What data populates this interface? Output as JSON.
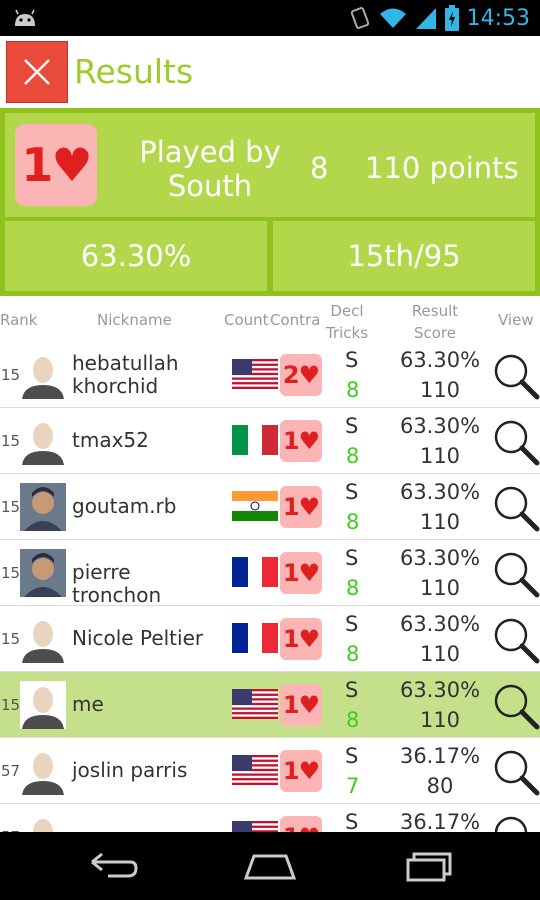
{
  "status_bar": {
    "time": "14:53",
    "icons": [
      "android-icon",
      "vibrate-icon",
      "wifi-icon",
      "signal-icon",
      "battery-icon"
    ]
  },
  "header": {
    "title": "Results",
    "close_icon": "close-icon"
  },
  "summary": {
    "contract": "1♥",
    "played_by": "Played by South",
    "tricks": "8",
    "points": "110 points",
    "percentage": "63.30%",
    "ranking": "15th/95"
  },
  "columns": {
    "rank": "Rank",
    "nickname": "Nickname",
    "country": "Country",
    "contract": "Contract",
    "decl": "Decl",
    "tricks": "Tricks",
    "result": "Result",
    "score": "Score",
    "view": "View"
  },
  "rows": [
    {
      "rank": "15",
      "nickname": "hebatullah khorchid",
      "avatar": "default",
      "country": "us",
      "contract": "2♥",
      "declarer": "S",
      "tricks": "8",
      "percent": "63.30%",
      "score": "110",
      "highlight": false
    },
    {
      "rank": "15",
      "nickname": "tmax52",
      "avatar": "default",
      "country": "it",
      "contract": "1♥",
      "declarer": "S",
      "tricks": "8",
      "percent": "63.30%",
      "score": "110",
      "highlight": false
    },
    {
      "rank": "15",
      "nickname": "goutam.rb",
      "avatar": "photo",
      "country": "in",
      "contract": "1♥",
      "declarer": "S",
      "tricks": "8",
      "percent": "63.30%",
      "score": "110",
      "highlight": false
    },
    {
      "rank": "15",
      "nickname": "pierre tronchon",
      "avatar": "photo",
      "country": "fr",
      "contract": "1♥",
      "declarer": "S",
      "tricks": "8",
      "percent": "63.30%",
      "score": "110",
      "highlight": false
    },
    {
      "rank": "15",
      "nickname": "Nicole Peltier",
      "avatar": "default",
      "country": "fr",
      "contract": "1♥",
      "declarer": "S",
      "tricks": "8",
      "percent": "63.30%",
      "score": "110",
      "highlight": false
    },
    {
      "rank": "15",
      "nickname": "me",
      "avatar": "default",
      "country": "us",
      "contract": "1♥",
      "declarer": "S",
      "tricks": "8",
      "percent": "63.30%",
      "score": "110",
      "highlight": true
    },
    {
      "rank": "57",
      "nickname": "joslin parris",
      "avatar": "default",
      "country": "us",
      "contract": "1♥",
      "declarer": "S",
      "tricks": "7",
      "percent": "36.17%",
      "score": "80",
      "highlight": false
    },
    {
      "rank": "57",
      "nickname": "",
      "avatar": "default",
      "country": "us",
      "contract": "1♥",
      "declarer": "S",
      "tricks": "",
      "percent": "36.17%",
      "score": "",
      "highlight": false
    }
  ],
  "nav_bar": {
    "icons": [
      "back-icon",
      "home-icon",
      "recent-apps-icon"
    ]
  },
  "colors": {
    "accent_green": "#9bcd2a",
    "panel_green": "#b3d74a",
    "panel_border": "#8fc21c",
    "close_red": "#e84b3a",
    "card_pink": "#fbb5b5",
    "heart_red": "#e02020",
    "tricks_green": "#3ccf1e",
    "highlight_row": "#c5e08a"
  }
}
